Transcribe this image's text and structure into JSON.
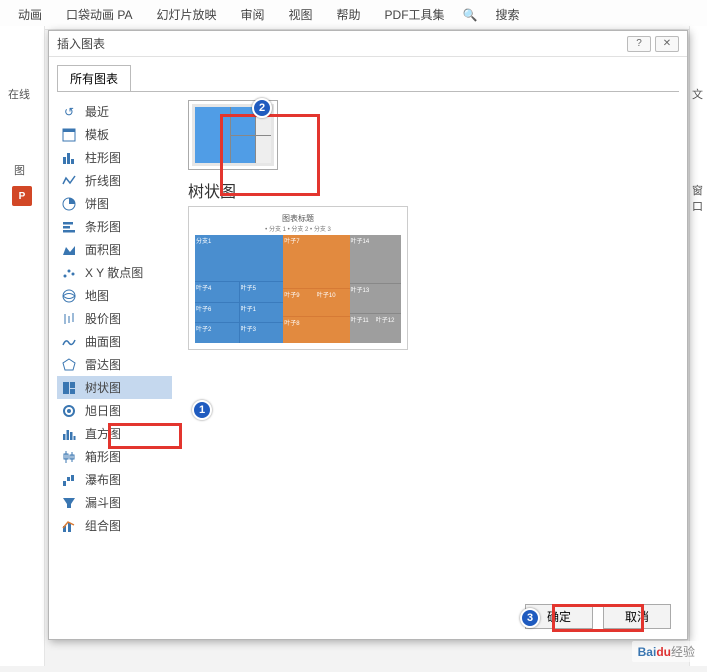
{
  "ribbon": {
    "tabs": [
      "动画",
      "口袋动画 PA",
      "幻灯片放映",
      "审阅",
      "视图",
      "帮助",
      "PDF工具集"
    ],
    "search_label": "搜索"
  },
  "left_strip": {
    "online": "在线",
    "pic": "图"
  },
  "right_strip": {
    "wen": "文",
    "win": "窗口"
  },
  "dialog": {
    "title": "插入图表",
    "tab": "所有图表",
    "categories": [
      "最近",
      "模板",
      "柱形图",
      "折线图",
      "饼图",
      "条形图",
      "面积图",
      "X Y 散点图",
      "地图",
      "股价图",
      "曲面图",
      "雷达图",
      "树状图",
      "旭日图",
      "直方图",
      "箱形图",
      "瀑布图",
      "漏斗图",
      "组合图"
    ],
    "selected_index": 12,
    "preview_title": "树状图",
    "ok": "确定",
    "cancel": "取消"
  },
  "chart_data": {
    "type": "bar",
    "title": "图表标题",
    "legend": "• 分支 1  • 分支 2  • 分支 3",
    "series": [
      {
        "name": "分支 1",
        "leaves": [
          "分支1",
          "叶子4",
          "叶子5",
          "叶子6",
          "叶子1",
          "叶子2",
          "叶子3"
        ]
      },
      {
        "name": "分支 2",
        "leaves": [
          "叶子7",
          "叶子9",
          "叶子10",
          "叶子8"
        ]
      },
      {
        "name": "分支 3",
        "leaves": [
          "叶子14",
          "叶子13",
          "叶子11",
          "叶子12"
        ]
      }
    ]
  },
  "annotations": {
    "n1": "1",
    "n2": "2",
    "n3": "3"
  },
  "watermark": {
    "brand": "Bai",
    "brand2": "du",
    "text": "经验"
  }
}
